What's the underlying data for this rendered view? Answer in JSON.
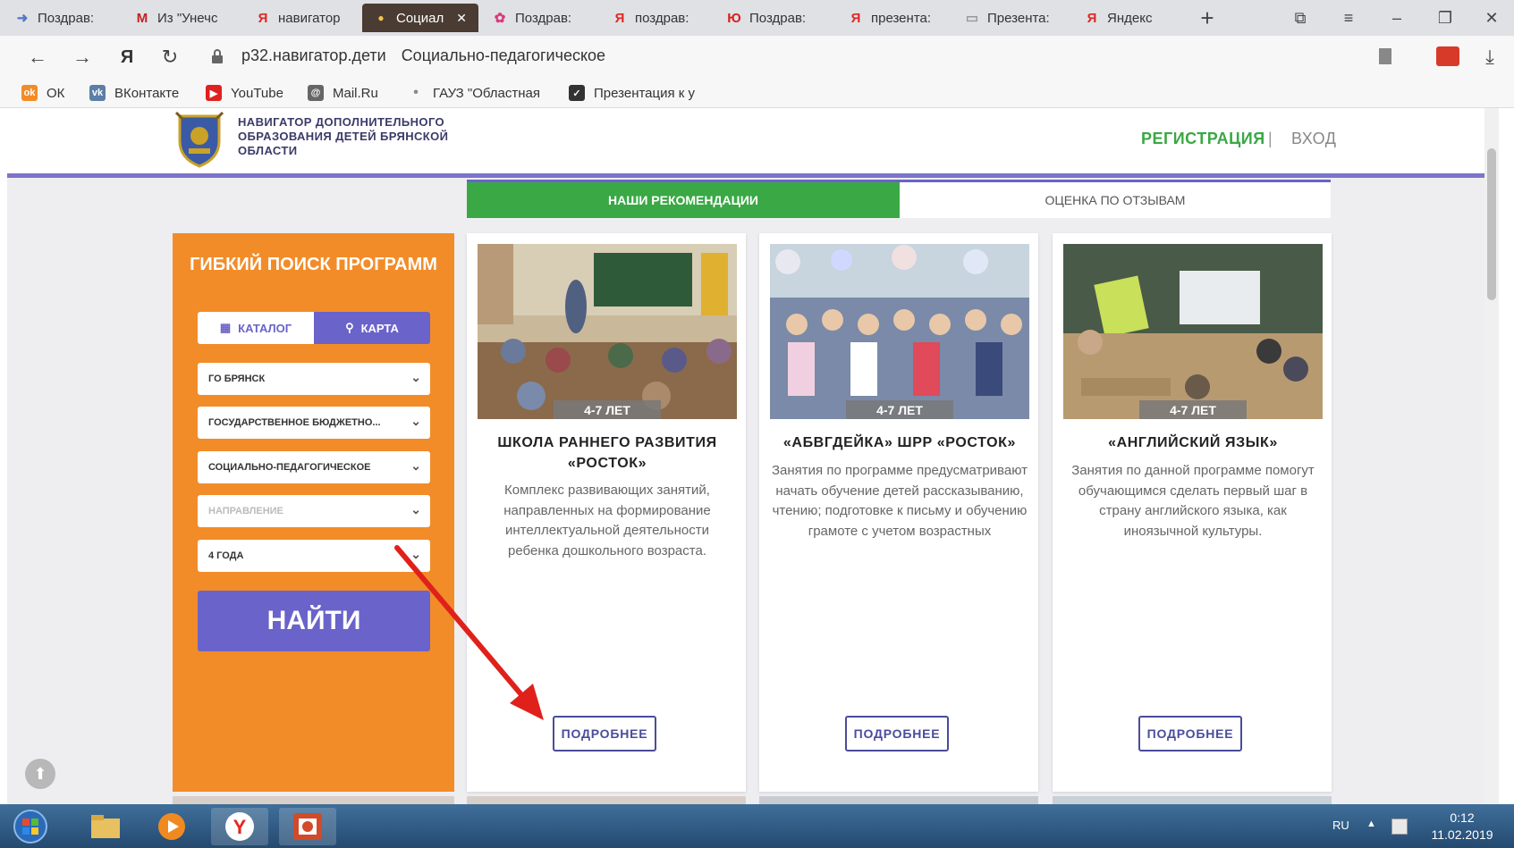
{
  "browser": {
    "tabs": [
      {
        "label": "Поздрав:",
        "icon": "arrow-icon"
      },
      {
        "label": "Из \"Унечс",
        "icon": "gmail-icon"
      },
      {
        "label": "навигатор",
        "icon": "yandex-icon"
      },
      {
        "label": "Социал",
        "icon": "site-icon",
        "active": true
      },
      {
        "label": "Поздрав:",
        "icon": "flower-icon"
      },
      {
        "label": "поздрав:",
        "icon": "yandex-icon"
      },
      {
        "label": "Поздрав:",
        "icon": "yu-icon"
      },
      {
        "label": "презента:",
        "icon": "yandex-icon"
      },
      {
        "label": "Презента:",
        "icon": "page-icon"
      },
      {
        "label": "Яндекс",
        "icon": "yandex-icon"
      }
    ],
    "tab_close": "✕",
    "new_tab": "+",
    "address": {
      "domain": "р32.навигатор.дети",
      "title": "Социально-педагогическое"
    },
    "bookmarks": [
      "ОК",
      "ВКонтакте",
      "YouTube",
      "Mail.Ru",
      "ГАУЗ \"Областная",
      "Презентация к у"
    ]
  },
  "site": {
    "logo_text": "НАВИГАТОР ДОПОЛНИТЕЛЬНОГО ОБРАЗОВАНИЯ ДЕТЕЙ БРЯНСКОЙ ОБЛАСТИ",
    "nav": {
      "register": "РЕГИСТРАЦИЯ",
      "separator": "|",
      "login": "ВХОД"
    },
    "tabs": {
      "recommend": "НАШИ РЕКОМЕНДАЦИИ",
      "rating": "ОЦЕНКА ПО ОТЗЫВАМ"
    },
    "search": {
      "title": "ГИБКИЙ ПОИСК ПРОГРАММ",
      "catalog": "КАТАЛОГ",
      "map": "КАРТА",
      "filters": [
        "ГО БРЯНСК",
        "ГОСУДАРСТВЕННОЕ БЮДЖЕТНО...",
        "СОЦИАЛЬНО-ПЕДАГОГИЧЕСКОЕ",
        "НАПРАВЛЕНИЕ",
        "4 ГОДА"
      ],
      "find": "НАЙТИ"
    },
    "cards": [
      {
        "age": "4-7 ЛЕТ",
        "title": "ШКОЛА РАННЕГО РАЗВИТИЯ «РОСТОК»",
        "desc": "Комплекс развивающих занятий, направленных на формирование интеллектуальной деятельности ребенка дошкольного возраста.",
        "more": "ПОДРОБНЕЕ"
      },
      {
        "age": "4-7 ЛЕТ",
        "title": "«АБВГДЕЙКА» ШРР «РОСТОК»",
        "desc": "Занятия по программе предусматривают начать обучение детей рассказыванию, чтению; подготовке к письму и обучению грамоте с учетом возрастных",
        "more": "ПОДРОБНЕЕ"
      },
      {
        "age": "4-7 ЛЕТ",
        "title": "«АНГЛИЙСКИЙ ЯЗЫК»",
        "desc": "Занятия по данной программе помогут обучающимся сделать первый шаг в страну английского языка, как иноязычной культуры.",
        "more": "ПОДРОБНЕЕ"
      }
    ]
  },
  "taskbar": {
    "lang": "RU",
    "time": "0:12",
    "date": "11.02.2019"
  },
  "colors": {
    "orange": "#f28c28",
    "green": "#3aa845",
    "purple": "#6a63c9",
    "navy": "#4a4c9a",
    "annotation_arrow": "#e0211b"
  }
}
